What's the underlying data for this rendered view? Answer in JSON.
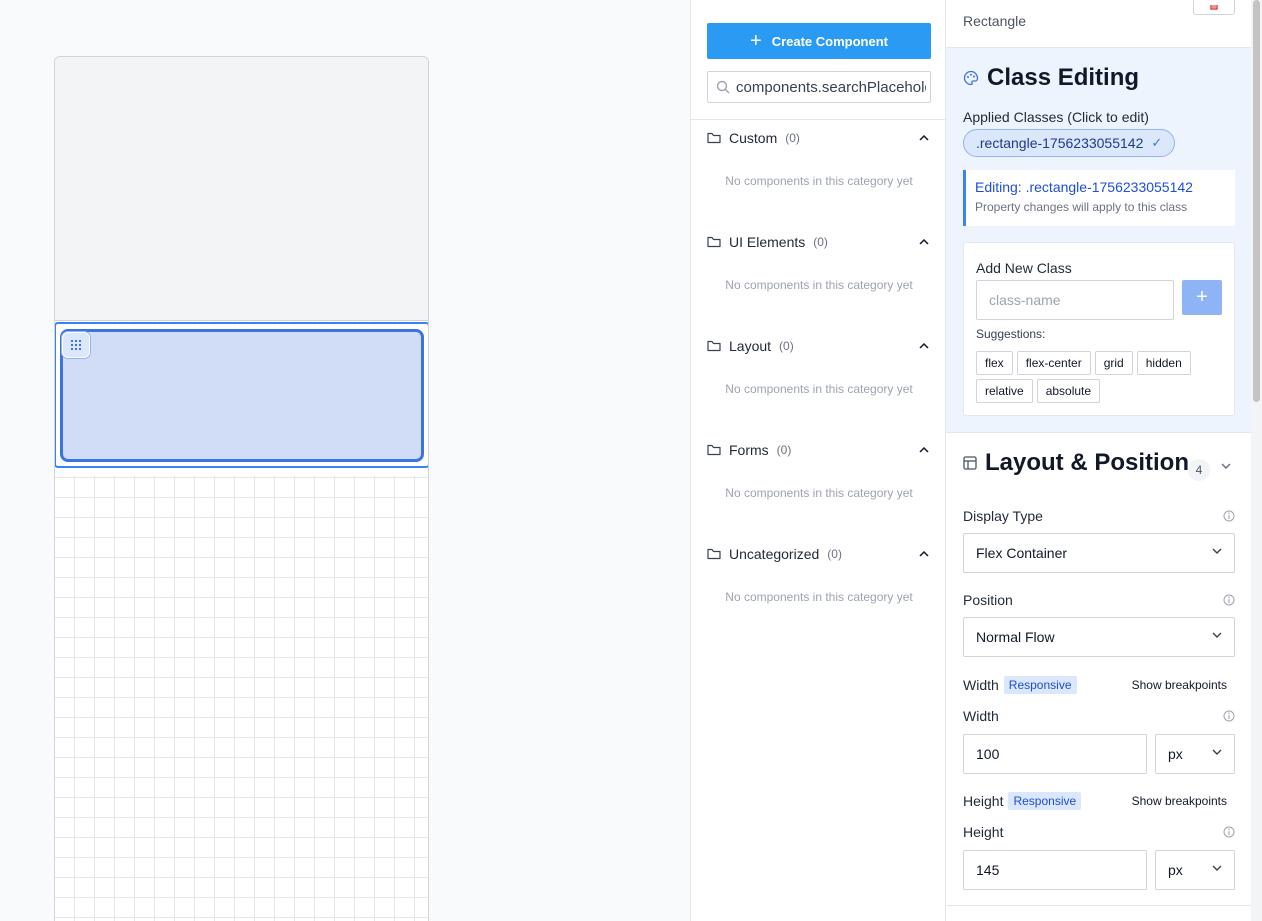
{
  "library": {
    "create_label": "Create Component",
    "search_value": "components.searchPlaceholder",
    "categories": [
      {
        "title": "Custom",
        "count": "(0)",
        "empty": "No components in this category yet"
      },
      {
        "title": "UI Elements",
        "count": "(0)",
        "empty": "No components in this category yet"
      },
      {
        "title": "Layout",
        "count": "(0)",
        "empty": "No components in this category yet"
      },
      {
        "title": "Forms",
        "count": "(0)",
        "empty": "No components in this category yet"
      },
      {
        "title": "Uncategorized",
        "count": "(0)",
        "empty": "No components in this category yet"
      }
    ]
  },
  "props": {
    "element_name": "Rectangle",
    "class_editing": {
      "title": "Class Editing",
      "applied_label": "Applied Classes (Click to edit)",
      "chip": ".rectangle-1756233055142",
      "chip_check": "✓",
      "editing_title": "Editing: .rectangle-1756233055142",
      "editing_sub": "Property changes will apply to this class",
      "add_label": "Add New Class",
      "input_placeholder": "class-name",
      "add_button": "+",
      "suggestions_label": "Suggestions:",
      "suggestions": [
        "flex",
        "flex-center",
        "grid",
        "hidden",
        "relative",
        "absolute"
      ]
    },
    "layout": {
      "title": "Layout & Position",
      "count": "4",
      "display_label": "Display Type",
      "display_value": "Flex Container",
      "position_label": "Position",
      "position_value": "Normal Flow",
      "width_group": "Width",
      "responsive": "Responsive",
      "show_breakpoints": "Show breakpoints",
      "width_label": "Width",
      "width_value": "100",
      "width_unit": "px",
      "height_group": "Height",
      "height_label": "Height",
      "height_value": "145",
      "height_unit": "px"
    }
  },
  "colors": {
    "accent": "#2b9af3",
    "selection": "#3b73e0",
    "panel_tint": "#eef4fe"
  }
}
